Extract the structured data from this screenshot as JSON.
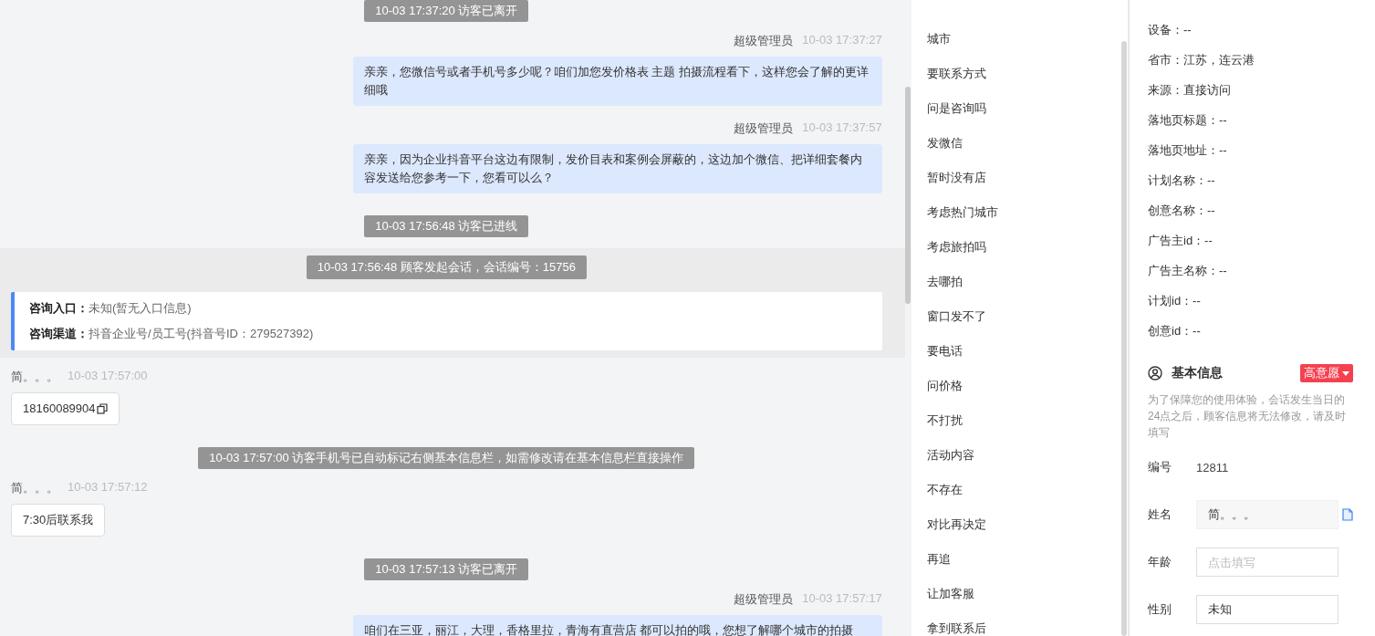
{
  "chat": {
    "messages": [
      {
        "kind": "notice",
        "text": "10-03 17:37:20 访客已离开"
      },
      {
        "kind": "agent",
        "sender": "超级管理员",
        "time": "10-03 17:37:27",
        "text": "亲亲，您微信号或者手机号多少呢？咱们加您发价格表 主题 拍摄流程看下，这样您会了解的更详细哦"
      },
      {
        "kind": "agent",
        "sender": "超级管理员",
        "time": "10-03 17:37:57",
        "text": "亲亲，因为企业抖音平台这边有限制，发价目表和案例会屏蔽的，这边加个微信、把详细套餐内容发送给您参考一下，您看可以么？"
      },
      {
        "kind": "notice",
        "text": "10-03 17:56:48 访客已进线"
      },
      {
        "kind": "session",
        "text": "10-03 17:56:48 顾客发起会话，会话编号：15756",
        "entries": [
          {
            "label": "咨询入口：",
            "value": "未知(暂无入口信息)"
          },
          {
            "label": "咨询渠道：",
            "value": "抖音企业号/员工号(抖音号ID：279527392)"
          }
        ]
      },
      {
        "kind": "visitor",
        "sender": "简。。。",
        "time": "10-03 17:57:00",
        "text": "18160089904",
        "copyable": true
      },
      {
        "kind": "notice",
        "text": "10-03 17:57:00 访客手机号已自动标记右侧基本信息栏，如需修改请在基本信息栏直接操作"
      },
      {
        "kind": "visitor",
        "sender": "简。。。",
        "time": "10-03 17:57:12",
        "text": "7:30后联系我",
        "copyable": false
      },
      {
        "kind": "notice",
        "text": "10-03 17:57:13 访客已离开"
      },
      {
        "kind": "agent",
        "sender": "超级管理员",
        "time": "10-03 17:57:17",
        "text": "咱们在三亚，丽江，大理，香格里拉，青海有直营店 都可以拍的哦，您想了解哪个城市的拍摄"
      }
    ]
  },
  "quick_replies": [
    "城市",
    "要联系方式",
    "问是咨询吗",
    "发微信",
    "暂时没有店",
    "考虑热门城市",
    "考虑旅拍吗",
    "去哪拍",
    "窗口发不了",
    "要电话",
    "问价格",
    "不打扰",
    "活动内容",
    "不存在",
    "对比再决定",
    "再追",
    "让加客服",
    "拿到联系后"
  ],
  "visit_info": [
    "设备：--",
    "省市：江苏，连云港",
    "来源：直接访问",
    "落地页标题：--",
    "落地页地址：--",
    "计划名称：--",
    "创意名称：--",
    "广告主id：--",
    "广告主名称：--",
    "计划id：--",
    "创意id：--"
  ],
  "basic_info": {
    "title": "基本信息",
    "intent": "高意愿",
    "note": "为了保障您的使用体验，会话发生当日的24点之后，顾客信息将无法修改，请及时填写",
    "fields": [
      {
        "kind": "text",
        "label": "编号",
        "value": "12811"
      },
      {
        "kind": "input",
        "label": "姓名",
        "value": "简。。。",
        "copyable": true
      },
      {
        "kind": "input",
        "label": "年龄",
        "placeholder": "点击填写"
      },
      {
        "kind": "input",
        "label": "性别",
        "value": "未知"
      }
    ]
  }
}
